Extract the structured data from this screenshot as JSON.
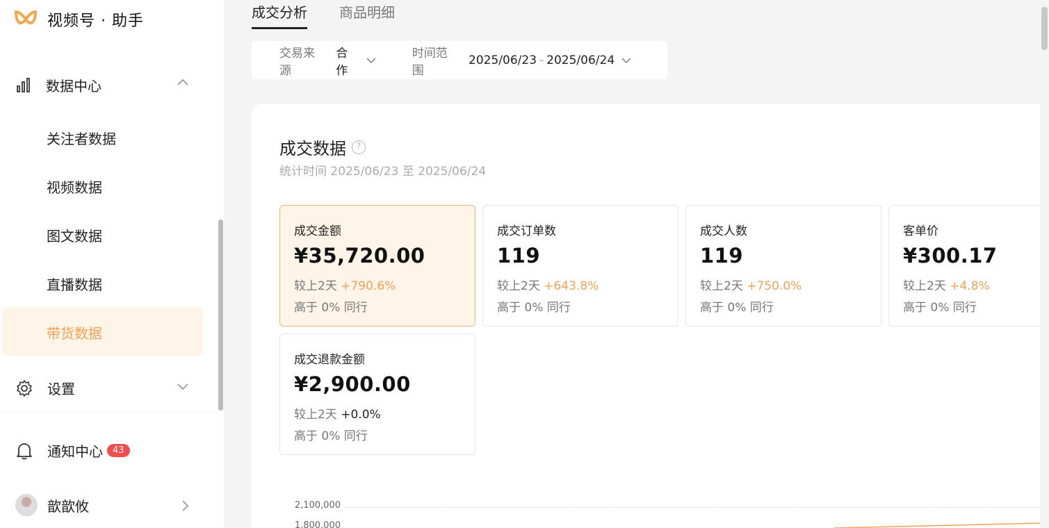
{
  "app": {
    "title": "视频号 · 助手"
  },
  "sidebar": {
    "group": {
      "label": "数据中心",
      "icon": "bar-chart-icon"
    },
    "items": [
      {
        "label": "关注者数据"
      },
      {
        "label": "视频数据"
      },
      {
        "label": "图文数据"
      },
      {
        "label": "直播数据"
      },
      {
        "label": "带货数据",
        "active": true
      }
    ],
    "settings": {
      "label": "设置",
      "icon": "gear-icon"
    },
    "notifications": {
      "label": "通知中心",
      "count": "43",
      "icon": "bell-icon"
    },
    "user": {
      "name": "歆歆攸"
    }
  },
  "tabs": [
    {
      "label": "成交分析",
      "active": true
    },
    {
      "label": "商品明细"
    }
  ],
  "filters": {
    "source_label": "交易来源",
    "source_value": "合作",
    "range_label": "时间范围",
    "range_start": "2025/06/23",
    "range_sep": "-",
    "range_end": "2025/06/24"
  },
  "panel": {
    "title": "成交数据",
    "subtitle": "统计时间 2025/06/23 至 2025/06/24"
  },
  "metrics": [
    {
      "title": "成交金额",
      "value": "¥35,720.00",
      "change_label": "较上2天",
      "change": "+790.6%",
      "peer": "高于 0% 同行"
    },
    {
      "title": "成交订单数",
      "value": "119",
      "change_label": "较上2天",
      "change": "+643.8%",
      "peer": "高于 0% 同行"
    },
    {
      "title": "成交人数",
      "value": "119",
      "change_label": "较上2天",
      "change": "+750.0%",
      "peer": "高于 0% 同行"
    },
    {
      "title": "客单价",
      "value": "¥300.17",
      "change_label": "较上2天",
      "change": "+4.8%",
      "peer": "高于 0% 同行"
    },
    {
      "title": "成交退款金额",
      "value": "¥2,900.00",
      "change_label": "较上2天",
      "change": "+0.0%",
      "peer": "高于 0% 同行"
    }
  ],
  "chart": {
    "y_ticks": [
      "2,100,000",
      "1,800,000"
    ],
    "line_color": "#f0a156"
  },
  "colors": {
    "accent": "#f0a156",
    "badge": "#f24c4c"
  }
}
